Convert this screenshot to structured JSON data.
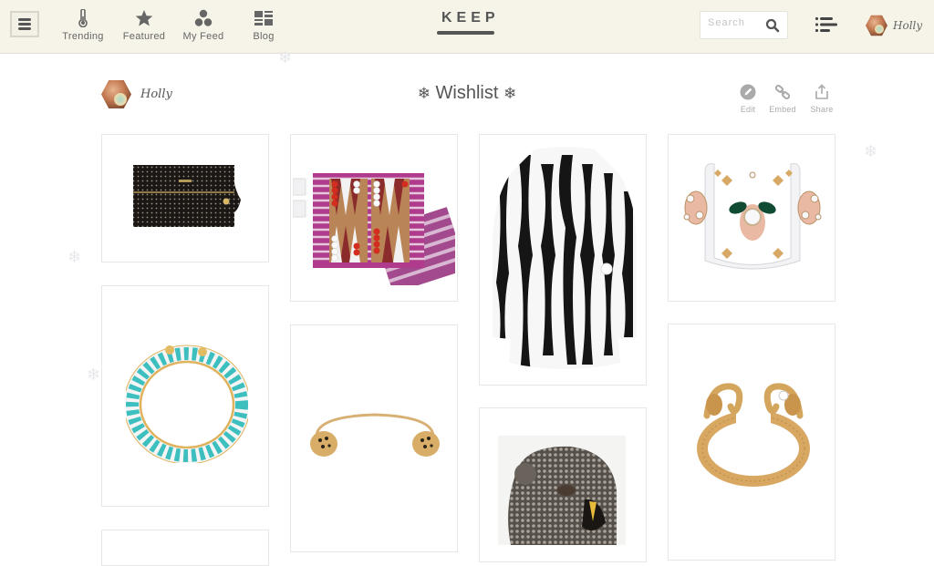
{
  "topbar": {
    "menu_icon": "hamburger-menu-icon",
    "nav": [
      {
        "label": "Trending",
        "icon": "thermometer-icon"
      },
      {
        "label": "Featured",
        "icon": "star-icon"
      },
      {
        "label": "My Feed",
        "icon": "hexagon-cluster-icon"
      },
      {
        "label": "Blog",
        "icon": "blog-grid-icon"
      }
    ],
    "logo": "KEEP",
    "search": {
      "placeholder": "Search",
      "value": "",
      "icon": "search-icon"
    },
    "list_icon": "list-icon",
    "user": {
      "name": "Holly",
      "avatar": "user-avatar"
    }
  },
  "profile": {
    "name": "Holly"
  },
  "collection": {
    "title": "Wishlist",
    "title_decoration": "❄",
    "actions": [
      {
        "label": "Edit",
        "icon": "pencil-icon"
      },
      {
        "label": "Embed",
        "icon": "link-icon"
      },
      {
        "label": "Share",
        "icon": "share-icon"
      }
    ]
  },
  "products": [
    {
      "item": "black sequin clutch",
      "column": 1
    },
    {
      "item": "pink backgammon set",
      "column": 2
    },
    {
      "item": "black and white striped fur coat",
      "column": 3
    },
    {
      "item": "jeweled lucite cuff",
      "column": 4
    },
    {
      "item": "turquoise giraffe bangle",
      "column": 1
    },
    {
      "item": "gold leopard head cuff",
      "column": 2
    },
    {
      "item": "pave panther ring",
      "column": 3
    },
    {
      "item": "gold elephant bangle",
      "column": 4
    },
    {
      "item": "partially visible item",
      "column": 1
    }
  ],
  "decoration": {
    "snowflake": "❄"
  },
  "colors": {
    "topbar_bg": "#f6f4e8",
    "text": "#555555",
    "card_border": "#e7e7e7"
  }
}
